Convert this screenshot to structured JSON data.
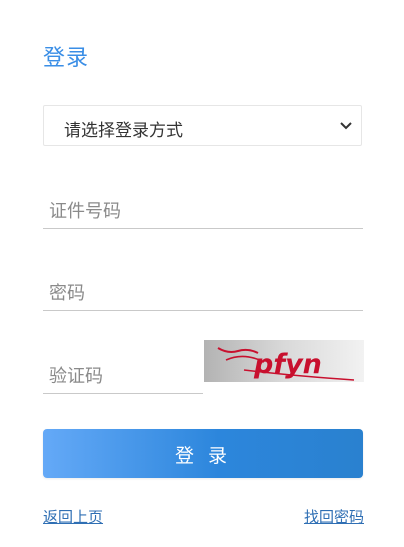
{
  "login": {
    "title": "登录",
    "method_select": {
      "selected": "请选择登录方式"
    },
    "id_field": {
      "placeholder": "证件号码"
    },
    "password_field": {
      "placeholder": "密码"
    },
    "captcha_field": {
      "placeholder": "验证码"
    },
    "captcha_image": {
      "text": "pfyn"
    },
    "submit_label": "登 录",
    "back_link": "返回上页",
    "forgot_link": "找回密码"
  },
  "colors": {
    "title": "#3a8ee6",
    "button_start": "#64a9f7",
    "button_end": "#2a81cf",
    "link": "#2f6fb4",
    "captcha_text": "#c8102e"
  },
  "icons": {
    "select_arrow": "chevron-down-icon"
  }
}
